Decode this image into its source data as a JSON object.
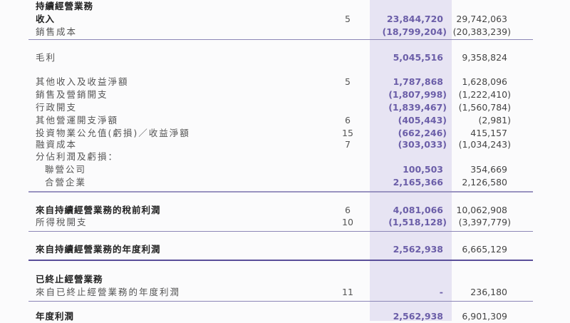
{
  "colors": {
    "current_year": "#6b5ea8",
    "shade": "#e7e4f3",
    "rule": "#8c86b6"
  },
  "rows": [
    {
      "label": "持續經營業務",
      "note": "",
      "current": "",
      "prior": ""
    },
    {
      "label": "收入",
      "note": "5",
      "current": "23,844,720",
      "prior": "29,742,063"
    },
    {
      "label": "銷售成本",
      "note": "",
      "current": "(18,799,204)",
      "prior": "(20,383,239)"
    },
    {
      "label": "毛利",
      "note": "",
      "current": "5,045,516",
      "prior": "9,358,824"
    },
    {
      "label": "其他收入及收益淨額",
      "note": "5",
      "current": "1,787,868",
      "prior": "1,628,096"
    },
    {
      "label": "銷售及營銷開支",
      "note": "",
      "current": "(1,807,998)",
      "prior": "(1,222,410)"
    },
    {
      "label": "行政開支",
      "note": "",
      "current": "(1,839,467)",
      "prior": "(1,560,784)"
    },
    {
      "label": "其他營運開支淨額",
      "note": "6",
      "current": "(405,443)",
      "prior": "(2,981)"
    },
    {
      "label": "投資物業公允值(虧損)／收益淨額",
      "note": "15",
      "current": "(662,246)",
      "prior": "415,157"
    },
    {
      "label": "融資成本",
      "note": "7",
      "current": "(303,033)",
      "prior": "(1,034,243)"
    },
    {
      "label": "分佔利潤及虧損：",
      "note": "",
      "current": "",
      "prior": ""
    },
    {
      "label": "聯營公司",
      "note": "",
      "current": "100,503",
      "prior": "354,669"
    },
    {
      "label": "合營企業",
      "note": "",
      "current": "2,165,366",
      "prior": "2,126,580"
    },
    {
      "label": "來自持續經營業務的稅前利潤",
      "note": "6",
      "current": "4,081,066",
      "prior": "10,062,908"
    },
    {
      "label": "所得稅開支",
      "note": "10",
      "current": "(1,518,128)",
      "prior": "(3,397,779)"
    },
    {
      "label": "來自持續經營業務的年度利潤",
      "note": "",
      "current": "2,562,938",
      "prior": "6,665,129"
    },
    {
      "label": "已終止經營業務",
      "note": "",
      "current": "",
      "prior": ""
    },
    {
      "label": "來自已終止經營業務的年度利潤",
      "note": "11",
      "current": "-",
      "prior": "236,180"
    },
    {
      "label": "年度利潤",
      "note": "",
      "current": "2,562,938",
      "prior": "6,901,309"
    }
  ]
}
